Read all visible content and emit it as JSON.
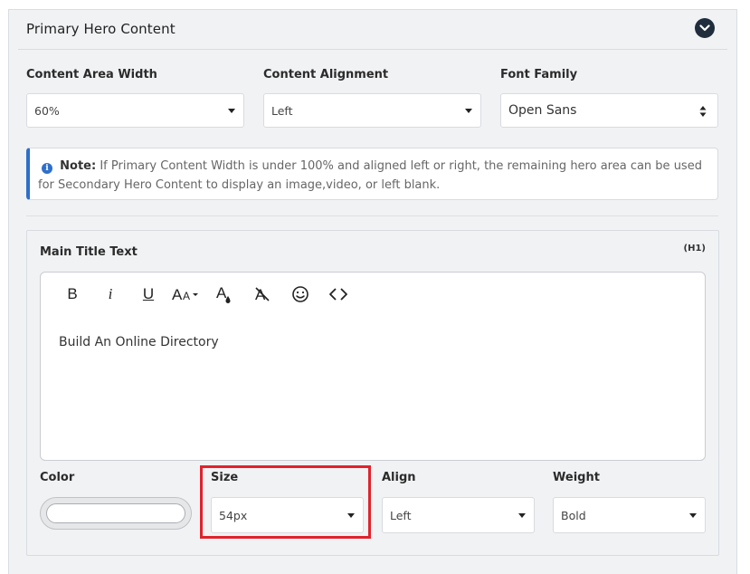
{
  "panel": {
    "title": "Primary Hero Content"
  },
  "fields": {
    "content_width": {
      "label": "Content Area Width",
      "value": "60%"
    },
    "content_alignment": {
      "label": "Content Alignment",
      "value": "Left"
    },
    "font_family": {
      "label": "Font Family",
      "value": "Open Sans"
    }
  },
  "note": {
    "prefix": "Note:",
    "text": "If Primary Content Width is under 100% and aligned left or right, the remaining hero area can be used for Secondary Hero Content to display an image,video, or left blank."
  },
  "main_title": {
    "label": "Main Title Text",
    "badge": "(H1)",
    "content": "Build An Online Directory",
    "toolbar": [
      "bold-icon",
      "italic-icon",
      "underline-icon",
      "font-size-icon",
      "text-color-icon",
      "clear-format-icon",
      "emoji-icon",
      "code-view-icon"
    ]
  },
  "style": {
    "color": {
      "label": "Color",
      "value": "#ffffff"
    },
    "size": {
      "label": "Size",
      "value": "54px"
    },
    "align": {
      "label": "Align",
      "value": "Left"
    },
    "weight": {
      "label": "Weight",
      "value": "Bold"
    }
  },
  "colors": {
    "accent": "#2f6fcb",
    "highlight": "#e0232d",
    "toggle": "#1f2d3d"
  }
}
